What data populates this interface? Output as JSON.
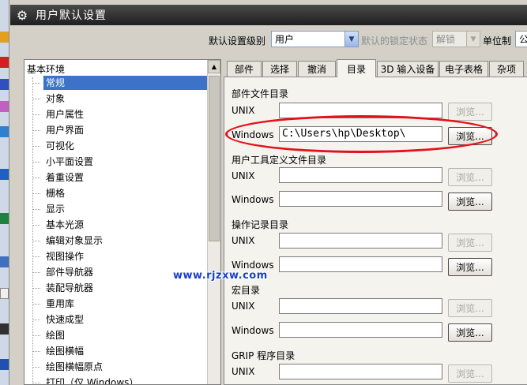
{
  "window": {
    "title": "用户默认设置"
  },
  "toolbar": {
    "level_label": "默认设置级别",
    "level_value": "用户",
    "lock_label": "默认的锁定状态",
    "lock_value": "解锁",
    "unit_label": "单位制",
    "unit_value": "公"
  },
  "tree": {
    "root": "基本环境",
    "selected_index": 0,
    "items": [
      "常规",
      "对象",
      "用户属性",
      "用户界面",
      "可视化",
      "小平面设置",
      "着重设置",
      "栅格",
      "显示",
      "基本光源",
      "编辑对象显示",
      "视图操作",
      "部件导航器",
      "装配导航器",
      "重用库",
      "快速成型",
      "绘图",
      "绘图横幅",
      "绘图横幅原点",
      "打印（仅 Windows）"
    ]
  },
  "tabs": {
    "active_index": 3,
    "items": [
      "部件",
      "选择",
      "撤消",
      "目录",
      "3D 输入设备",
      "电子表格",
      "杂项"
    ]
  },
  "sections": {
    "part_files": {
      "title": "部件文件目录",
      "unix_label": "UNIX",
      "unix_value": "",
      "windows_label": "Windows",
      "windows_value": "C:\\Users\\hp\\Desktop\\"
    },
    "user_tools": {
      "title": "用户工具定义文件目录",
      "unix_label": "UNIX",
      "unix_value": "",
      "windows_label": "Windows",
      "windows_value": ""
    },
    "journal": {
      "title": "操作记录目录",
      "unix_label": "UNIX",
      "unix_value": "",
      "windows_label": "Windows",
      "windows_value": ""
    },
    "macro": {
      "title": "宏目录",
      "unix_label": "UNIX",
      "unix_value": "",
      "windows_label": "Windows",
      "windows_value": ""
    },
    "grip": {
      "title": "GRIP 程序目录",
      "unix_label": "UNIX",
      "unix_value": ""
    }
  },
  "browse_label": "浏览...",
  "watermark": "www.rjzxw.com",
  "colors": {
    "highlight_ellipse": "#e5101b",
    "selection": "#3a73c8",
    "watermark": "#1a3fc9"
  },
  "icons": {
    "title": "gear-icon"
  }
}
